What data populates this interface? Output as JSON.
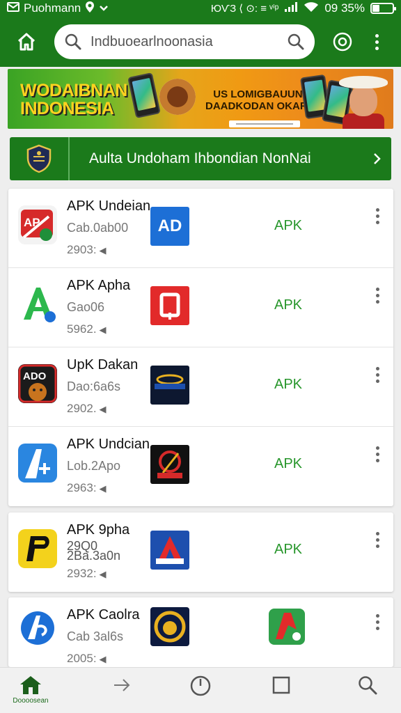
{
  "status_bar": {
    "notification_title": "Puohmann",
    "right_text": "ЮѴЗ ⟨ ⊙: ≡  ᵛⁱᵖ",
    "battery_text": "09 35%",
    "battery_level": 0.35
  },
  "app_bar": {
    "search_query": "Indbuoearlnoonasia"
  },
  "banner": {
    "title_line1": "WODAIBNAN",
    "title_line2": "INDONESIA",
    "sub_line1": "US LOMIGBAUUN",
    "sub_line2": "DAADKODAN OKARI"
  },
  "promo": {
    "label": "Aulta Undoham Ihbondian NonNai"
  },
  "app_list": [
    {
      "name": "APK Undeian",
      "developer": "Cab.0ab00",
      "size": "2903:",
      "tag": "APK",
      "icon": "apk-red-icon",
      "thumb": "ap-blue-logo"
    },
    {
      "name": "APK Apha",
      "developer": "Gao06",
      "size": "5962.",
      "tag": "APK",
      "icon": "a-green-icon",
      "thumb": "d-red-logo"
    },
    {
      "name": "UpK Dakan",
      "developer": "Dao:6a6s",
      "size": "2902.",
      "tag": "APK",
      "icon": "ado-cookie-icon",
      "thumb": "dark-blue-logo"
    },
    {
      "name": "APK Undcian",
      "developer": "Lob.2Apo",
      "size": "2963:",
      "tag": "APK",
      "icon": "a-blue-icon",
      "thumb": "red-black-logo"
    },
    {
      "name": "APK 9pha",
      "developer": "2Ba.3a0n",
      "size": "2932:",
      "tag": "APK",
      "icon": "p-yellow-icon",
      "thumb": "a-red-blue-logo",
      "developer_prefix": "29Q0"
    },
    {
      "name": "APK Caolra",
      "developer": "Cab 3al6s",
      "size": "2005:",
      "tag": "",
      "icon": "a-blue-white-icon",
      "thumb": "circle-gold-logo",
      "extra_icon": "p-green-icon"
    }
  ],
  "bottom_nav": {
    "home_label": "Doooosean"
  },
  "colors": {
    "primary_green": "#1b7a1b",
    "apk_green": "#27962b",
    "banner_orange": "#f09a13"
  }
}
